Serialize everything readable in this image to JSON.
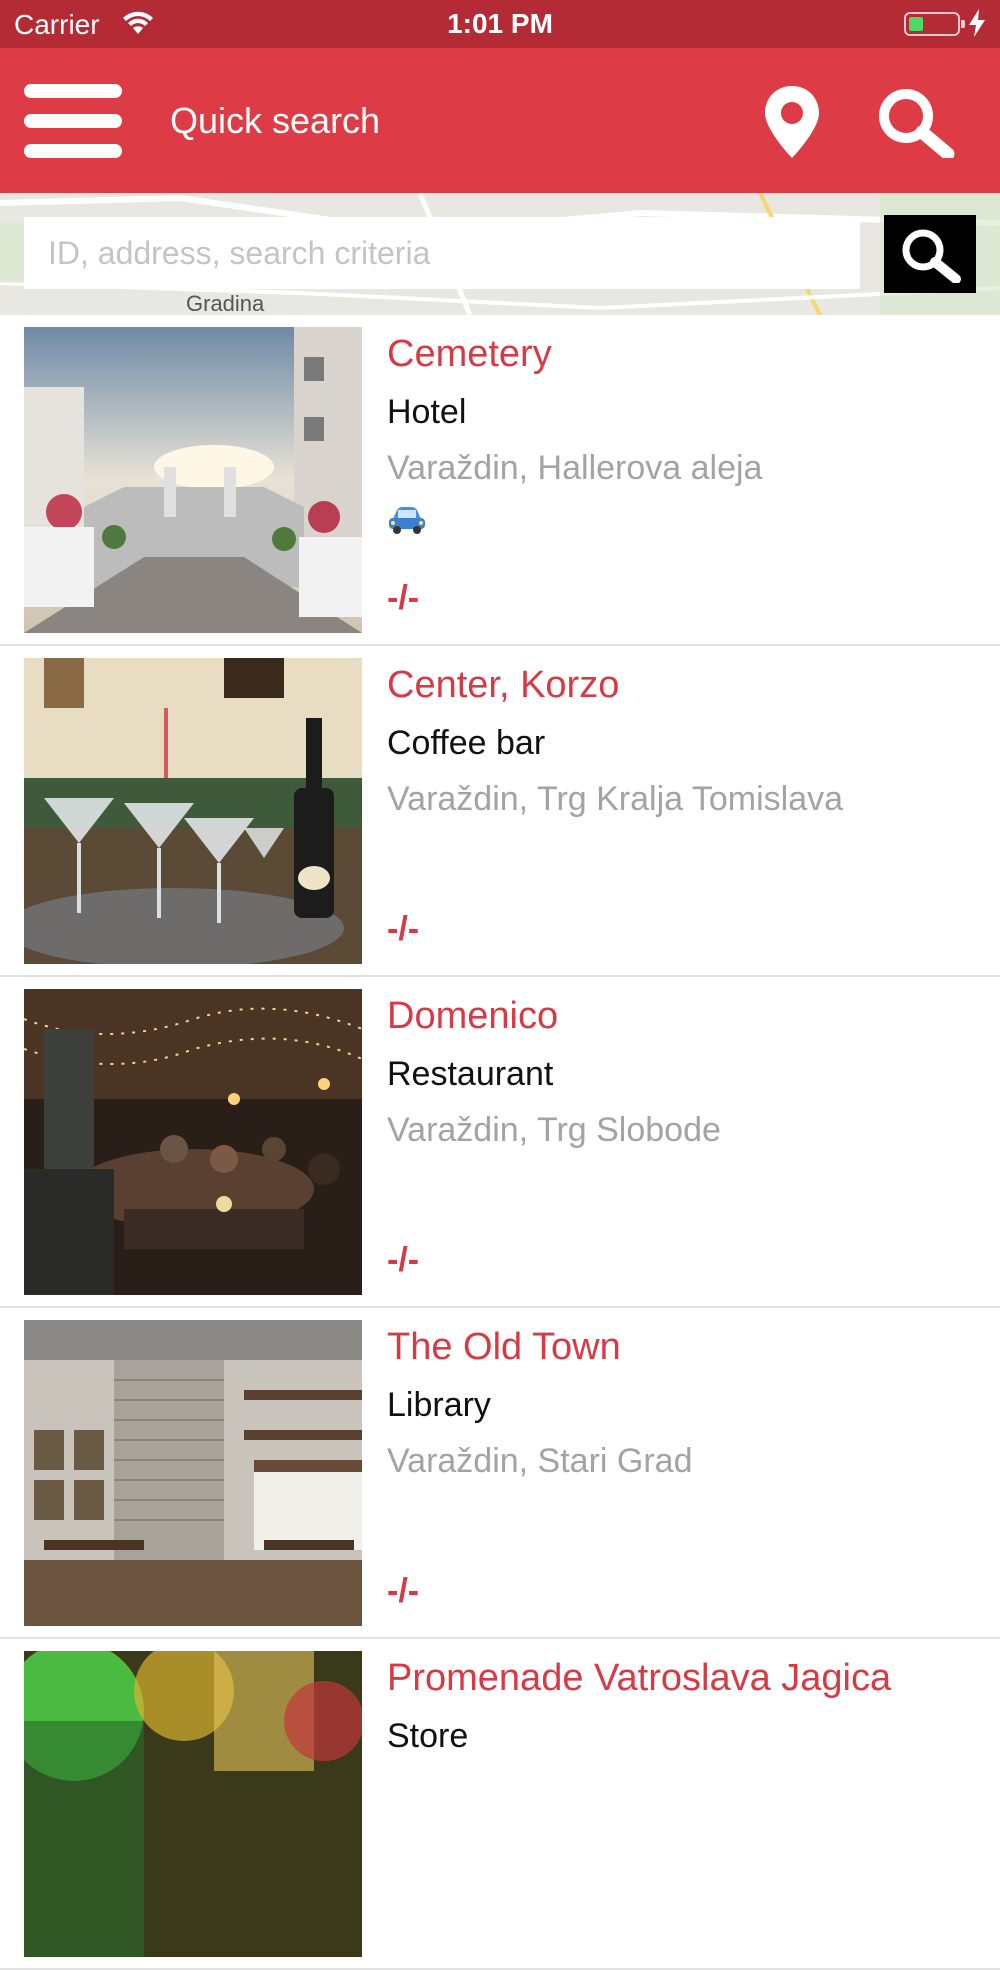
{
  "status_bar": {
    "carrier": "Carrier",
    "time": "1:01 PM",
    "battery_color": "#4cd964"
  },
  "header": {
    "title": "Quick search",
    "menu_icon": "hamburger-icon",
    "location_icon": "map-pin-icon",
    "search_icon": "search-icon",
    "background_color": "#dd3b46"
  },
  "search": {
    "placeholder": "ID, address, search criteria",
    "value": "",
    "map_label": "Gradina"
  },
  "results": [
    {
      "name": "Cemetery",
      "category": "Hotel",
      "address": "Varaždin, Hallerova aleja",
      "has_parking": true,
      "price": "-/-",
      "image": "bridge-promenade"
    },
    {
      "name": "Center, Korzo",
      "category": "Coffee bar",
      "address": "Varaždin, Trg Kralja Tomislava",
      "has_parking": false,
      "price": "-/-",
      "image": "martini-glasses"
    },
    {
      "name": "Domenico",
      "category": "Restaurant",
      "address": "Varaždin, Trg Slobode",
      "has_parking": false,
      "price": "-/-",
      "image": "restaurant-interior"
    },
    {
      "name": "The Old Town",
      "category": "Library",
      "address": "Varaždin, Stari Grad",
      "has_parking": false,
      "price": "-/-",
      "image": "cafe-interior"
    },
    {
      "name": "Promenade Vatroslava Jagica",
      "category": "Store",
      "address": "",
      "has_parking": false,
      "price": "",
      "image": "green-lights"
    }
  ],
  "colors": {
    "accent": "#d83a45",
    "status_bar": "#b42a35",
    "address_text": "#a3a3a3"
  }
}
